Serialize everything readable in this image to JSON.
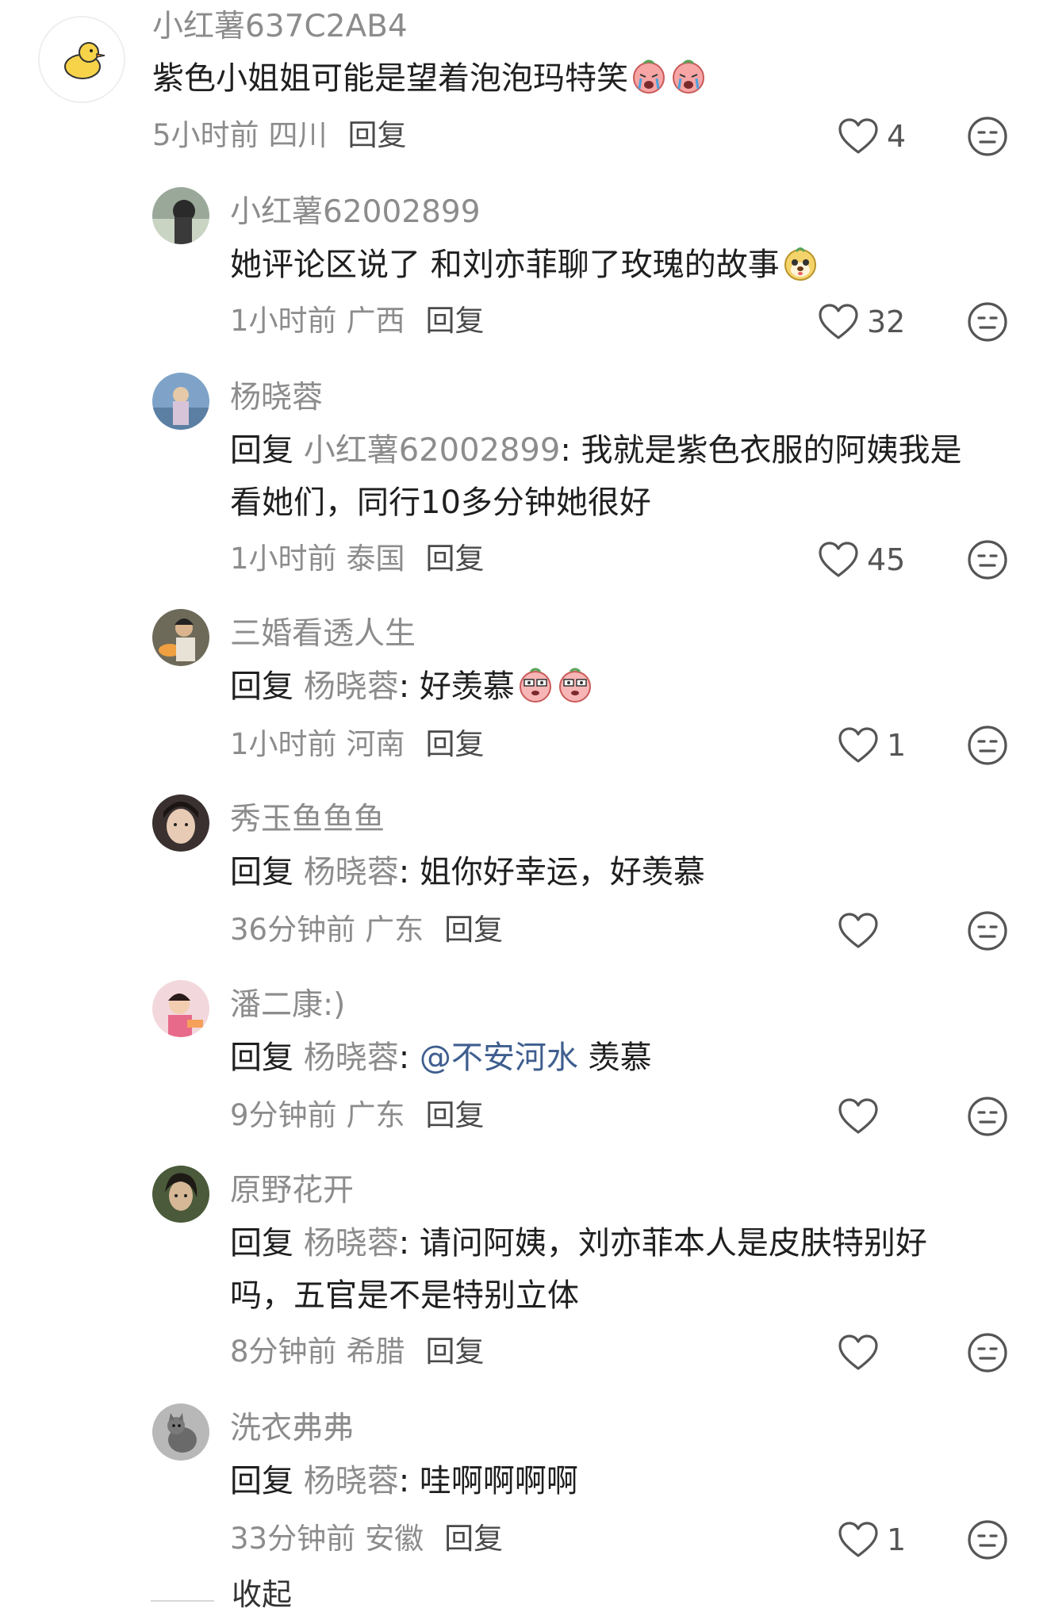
{
  "comments": [
    {
      "username": "小红薯637C2AB4",
      "text_lines": [
        "紫色小姐姐可能是望着泡泡玛特笑"
      ],
      "emojis": [
        "crying-face-emoji",
        "crying-face-emoji"
      ],
      "time": "5小时前",
      "location": "四川",
      "reply_label": "回复",
      "likes": "4"
    },
    {
      "username": "小红薯62002899",
      "text_lines": [
        "她评论区说了  和刘亦菲聊了玫瑰的故事"
      ],
      "emojis": [
        "puppy-face-emoji"
      ],
      "time": "1小时前",
      "location": "广西",
      "reply_label": "回复",
      "likes": "32"
    },
    {
      "username": "杨晓蓉",
      "reply_prefix": "回复",
      "reply_target": "小红薯62002899",
      "text_lines": [
        ": 我就是紫色衣服的阿姨我是",
        "看她们，同行10多分钟她很好"
      ],
      "time": "1小时前",
      "location": "泰国",
      "reply_label": "回复",
      "likes": "45"
    },
    {
      "username": "三婚看透人生",
      "reply_prefix": "回复",
      "reply_target": "杨晓蓉",
      "text_lines": [
        ": 好羡慕"
      ],
      "emojis": [
        "envy-face-emoji",
        "envy-face-emoji"
      ],
      "time": "1小时前",
      "location": "河南",
      "reply_label": "回复",
      "likes": "1"
    },
    {
      "username": "秀玉鱼鱼鱼",
      "reply_prefix": "回复",
      "reply_target": "杨晓蓉",
      "text_lines": [
        ": 姐你好幸运，好羡慕"
      ],
      "time": "36分钟前",
      "location": "广东",
      "reply_label": "回复",
      "likes": ""
    },
    {
      "username": "潘二康:)",
      "reply_prefix": "回复",
      "reply_target": "杨晓蓉",
      "text_lines": [
        ": "
      ],
      "mention": "@不安河水",
      "text_after": " 羡慕",
      "time": "9分钟前",
      "location": "广东",
      "reply_label": "回复",
      "likes": ""
    },
    {
      "username": "原野花开",
      "reply_prefix": "回复",
      "reply_target": "杨晓蓉",
      "text_lines": [
        ": 请问阿姨，刘亦菲本人是皮肤特别好",
        "吗，五官是不是特别立体"
      ],
      "time": "8分钟前",
      "location": "希腊",
      "reply_label": "回复",
      "likes": ""
    },
    {
      "username": "洗衣弗弗",
      "reply_prefix": "回复",
      "reply_target": "杨晓蓉",
      "text_lines": [
        ": 哇啊啊啊啊"
      ],
      "time": "33分钟前",
      "location": "安徽",
      "reply_label": "回复",
      "likes": "1"
    }
  ],
  "footer": {
    "collapse_label": "收起"
  },
  "icons": {
    "like": "heart-outline-icon",
    "dislike": "neutral-face-icon"
  },
  "colors": {
    "username": "#8c8c8c",
    "text": "#1f1f1f",
    "mention": "#3f5e8f"
  }
}
